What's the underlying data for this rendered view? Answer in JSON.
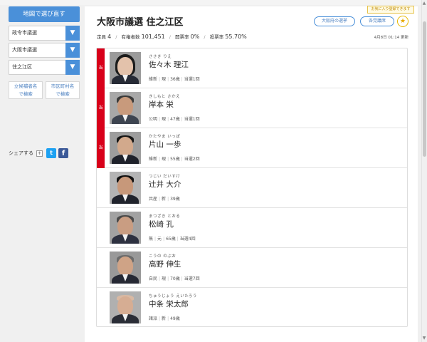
{
  "sidebar": {
    "map_button": "地図で選び直す",
    "selects": [
      {
        "value": "政令市議選"
      },
      {
        "value": "大阪市議選"
      },
      {
        "value": "住之江区"
      }
    ],
    "search_buttons": [
      {
        "line1": "立候補者名",
        "line2": "で検索"
      },
      {
        "line1": "市区町村名",
        "line2": "で検索"
      }
    ],
    "share_label": "シェアする",
    "share_plus": "+",
    "twitter_glyph": "t",
    "facebook_glyph": "f"
  },
  "header": {
    "title": "大阪市議選 住之江区",
    "quota_label": "定員",
    "quota_value": "4",
    "voters_label": "有権者数",
    "voters_value": "101,451",
    "counted_label": "開票率",
    "counted_value": "0%",
    "turnout_label": "投票率",
    "turnout_value": "55.70%",
    "pref_button": "大阪府の選挙",
    "party_button": "各党議席",
    "fav_tooltip": "お気に入り登録できます",
    "fav_star": "★",
    "updated": "4月8日 01:14 更新"
  },
  "candidates": [
    {
      "elected": "当",
      "kana": "ささき りえ",
      "name": "佐々木 理江",
      "party": "維新",
      "status": "現",
      "age": "36歳",
      "wins": "当選1回"
    },
    {
      "elected": "当",
      "kana": "きしもと さかえ",
      "name": "岸本 栄",
      "party": "公明",
      "status": "現",
      "age": "47歳",
      "wins": "当選1回"
    },
    {
      "elected": "当",
      "kana": "かたやま いっぽ",
      "name": "片山 一歩",
      "party": "維新",
      "status": "現",
      "age": "55歳",
      "wins": "当選2回"
    },
    {
      "elected": "",
      "kana": "つじい だいすけ",
      "name": "辻井 大介",
      "party": "共産",
      "status": "新",
      "age": "39歳",
      "wins": ""
    },
    {
      "elected": "",
      "kana": "まつざき とおる",
      "name": "松崎 孔",
      "party": "無",
      "status": "元",
      "age": "65歳",
      "wins": "当選4回"
    },
    {
      "elected": "",
      "kana": "こうの のぶお",
      "name": "高野 伸生",
      "party": "自民",
      "status": "現",
      "age": "70歳",
      "wins": "当選7回"
    },
    {
      "elected": "",
      "kana": "ちゅうじょう えいたろう",
      "name": "中条 栄太郎",
      "party": "諸派",
      "status": "新",
      "age": "49歳",
      "wins": ""
    }
  ],
  "colors": {
    "accent": "#4a90d9",
    "elected": "#d8001a",
    "twitter": "#1da1f2",
    "facebook": "#3b5998"
  }
}
